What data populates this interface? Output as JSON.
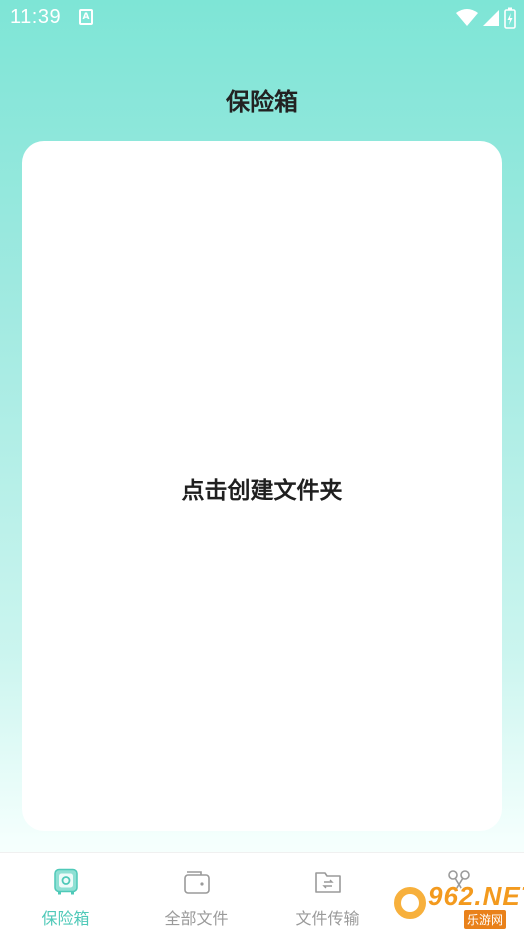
{
  "status_bar": {
    "time": "11:39",
    "notification_glyph": "A",
    "icons": [
      "wifi-icon",
      "signal-icon",
      "battery-charging-icon"
    ]
  },
  "page": {
    "title": "保险箱"
  },
  "vault_card": {
    "label": "点击创建文件夹"
  },
  "bottom_nav": {
    "items": [
      {
        "label": "保险箱",
        "icon": "safe-icon",
        "active": true
      },
      {
        "label": "全部文件",
        "icon": "wallet-folder-icon",
        "active": false
      },
      {
        "label": "文件传输",
        "icon": "transfer-folder-icon",
        "active": false
      },
      {
        "label": "",
        "icon": "scissors-icon",
        "active": false
      }
    ]
  },
  "watermark": {
    "brand": "962.NET",
    "sub": "乐游网"
  },
  "colors": {
    "accent": "#4fc9b8",
    "gradient_top": "#7ee5d6",
    "inactive": "#9a9a9a"
  }
}
